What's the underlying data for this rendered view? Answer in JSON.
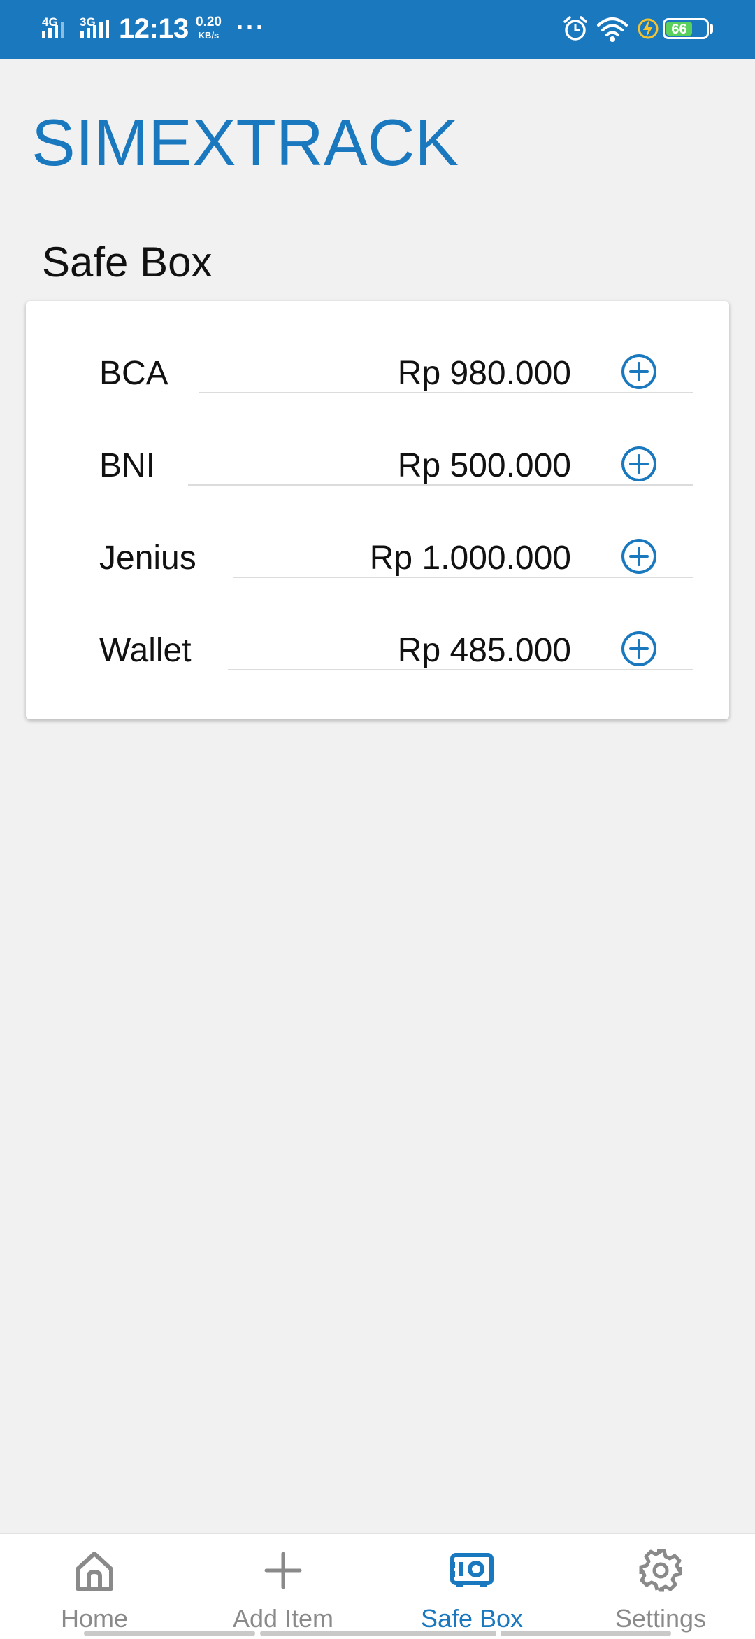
{
  "status_bar": {
    "net1": "4G",
    "net2": "3G",
    "time": "12:13",
    "speed_value": "0.20",
    "speed_unit": "KB/s",
    "more": "···",
    "battery_level": "66",
    "icons": [
      "signal-icon",
      "alarm-icon",
      "wifi-icon",
      "charging-icon",
      "battery-icon"
    ]
  },
  "app": {
    "title": "SIMEXTRACK",
    "accent_color": "#1a78bf"
  },
  "safe_box": {
    "title": "Safe Box",
    "accounts": [
      {
        "name": "BCA",
        "amount": "Rp 980.000"
      },
      {
        "name": "BNI",
        "amount": "Rp 500.000"
      },
      {
        "name": "Jenius",
        "amount": "Rp 1.000.000"
      },
      {
        "name": "Wallet",
        "amount": "Rp 485.000"
      }
    ],
    "row_action_icon": "plus-circle-icon"
  },
  "bottom_nav": {
    "items": [
      {
        "label": "Home",
        "icon": "home-icon",
        "active": false
      },
      {
        "label": "Add Item",
        "icon": "plus-icon",
        "active": false
      },
      {
        "label": "Safe Box",
        "icon": "safe-box-icon",
        "active": true
      },
      {
        "label": "Settings",
        "icon": "gear-icon",
        "active": false
      }
    ]
  }
}
